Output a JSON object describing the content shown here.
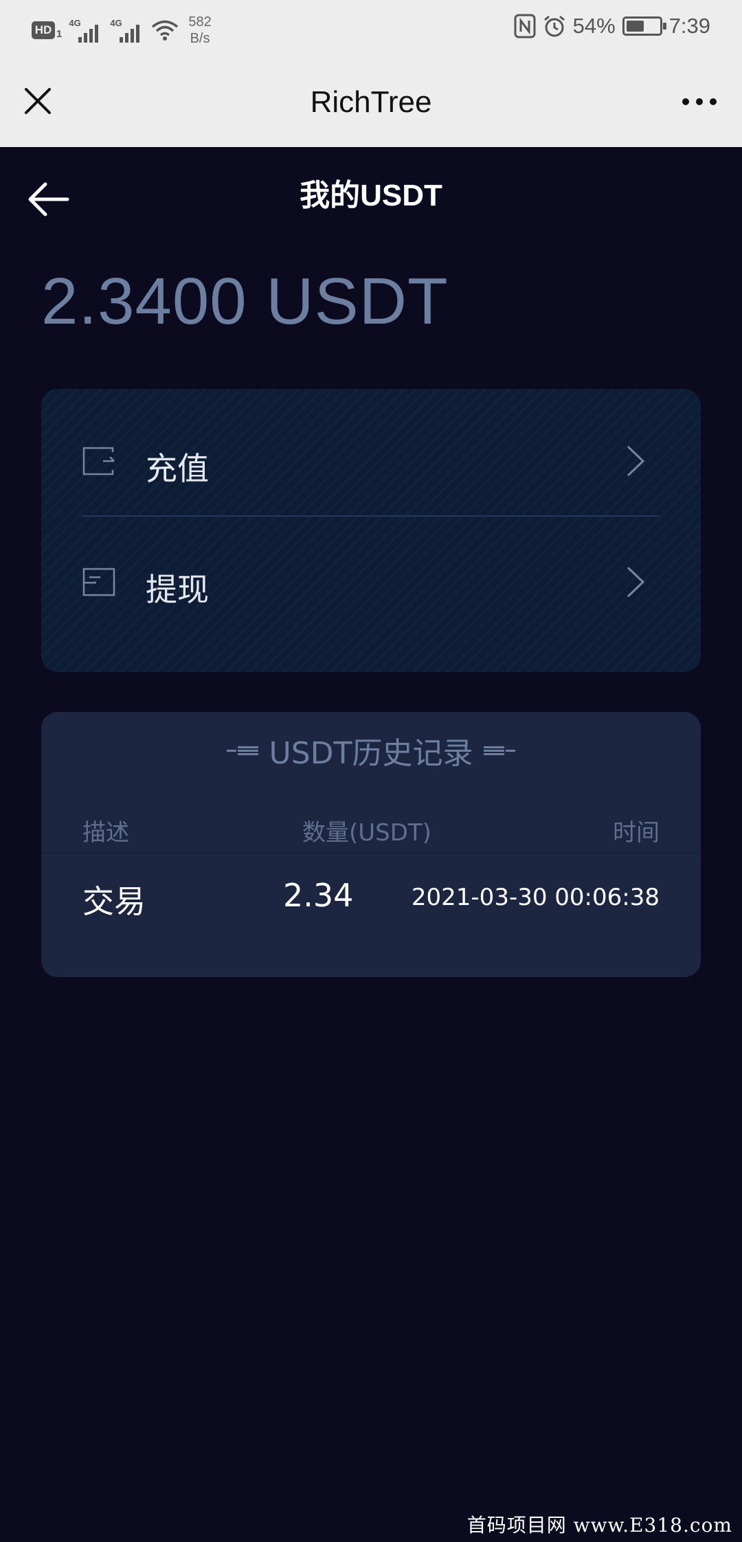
{
  "status_bar": {
    "hd_label": "HD",
    "hd_sub": "1",
    "signal1_label": "4G",
    "signal2_label": "4G",
    "net_speed_value": "582",
    "net_speed_unit": "B/s",
    "battery_percent": "54%",
    "battery_level": 0.54,
    "time": "7:39",
    "icons": [
      "hd-icon",
      "signal-icon",
      "signal-icon",
      "wifi-icon",
      "nfc-icon",
      "alarm-icon",
      "battery-icon"
    ]
  },
  "navbar": {
    "title": "RichTree",
    "icons": [
      "close-icon",
      "more-icon"
    ]
  },
  "page": {
    "title": "我的USDT",
    "balance": "2.3400 USDT",
    "actions": [
      {
        "label": "充值",
        "icon": "recharge-icon"
      },
      {
        "label": "提现",
        "icon": "withdraw-icon"
      }
    ],
    "colors": {
      "background": "#0b0a1f",
      "balance_text": "#6d7fa1",
      "action_card": "#0d1d35",
      "history_card": "#1c2640"
    }
  },
  "history": {
    "title": "USDT历史记录",
    "columns": [
      "描述",
      "数量(USDT)",
      "时间"
    ],
    "rows": [
      {
        "desc": "交易",
        "qty": "2.34",
        "time": "2021-03-30 00:06:38"
      }
    ]
  },
  "watermark": "首码项目网 www.E318.com"
}
